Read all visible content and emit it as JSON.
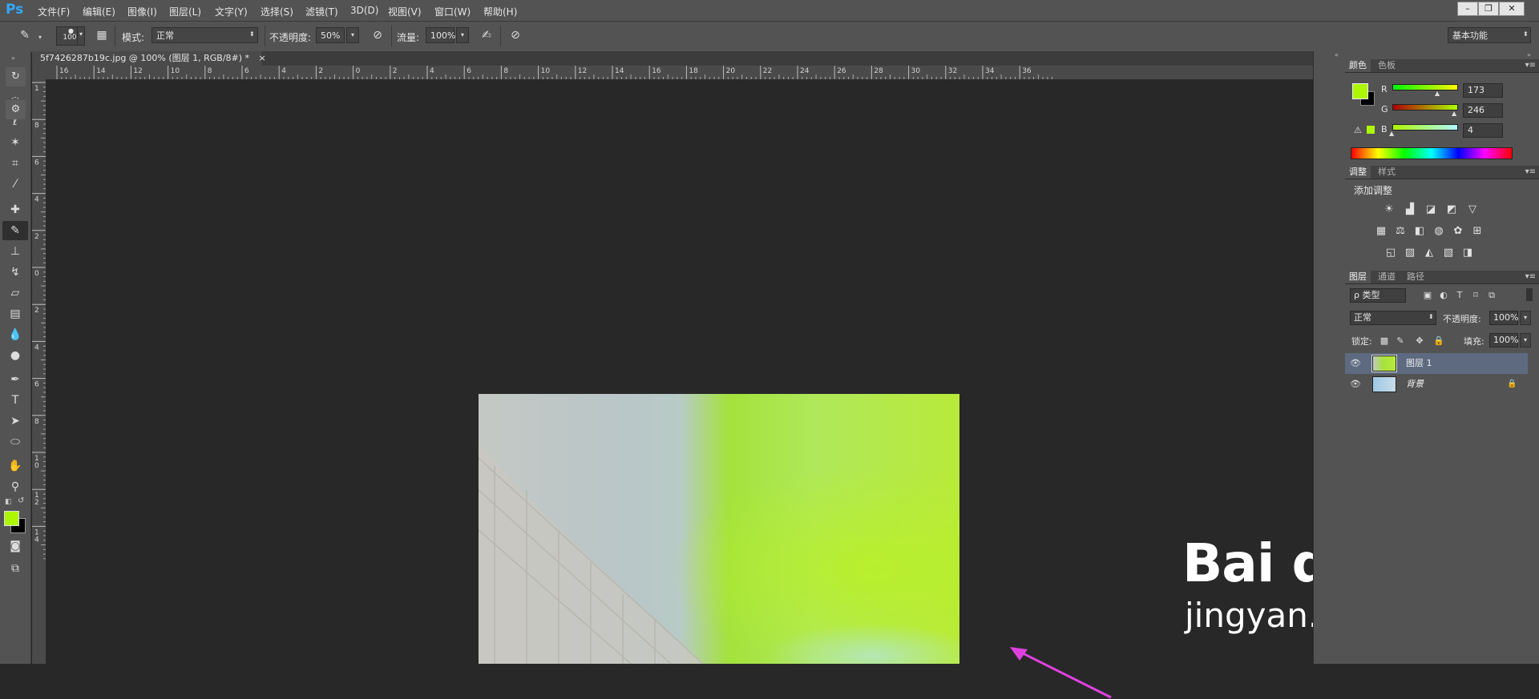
{
  "app": {
    "logo": "Ps"
  },
  "menu": [
    "文件(F)",
    "编辑(E)",
    "图像(I)",
    "图层(L)",
    "文字(Y)",
    "选择(S)",
    "滤镜(T)",
    "3D(D)",
    "视图(V)",
    "窗口(W)",
    "帮助(H)"
  ],
  "window_controls": {
    "minimize": "–",
    "restore": "❐",
    "close": "✕"
  },
  "options": {
    "brush_size": "100",
    "mode_label": "模式:",
    "mode_value": "正常",
    "opacity_label": "不透明度:",
    "opacity_value": "50%",
    "flow_label": "流量:",
    "flow_value": "100%",
    "workspace": "基本功能"
  },
  "document": {
    "tab_title": "5f7426287b19c.jpg @ 100% (图层 1, RGB/8#) *",
    "tab_close": "×"
  },
  "rulers": {
    "top": [
      "16",
      "14",
      "12",
      "10",
      "8",
      "6",
      "4",
      "2",
      "0",
      "2",
      "4",
      "6",
      "8",
      "10",
      "12",
      "14",
      "16",
      "18",
      "20",
      "22",
      "24",
      "26",
      "28",
      "30",
      "32",
      "34",
      "36"
    ],
    "left": [
      "1",
      "8",
      "6",
      "4",
      "2",
      "0",
      "2",
      "4",
      "6",
      "8",
      "10",
      "12",
      "14"
    ]
  },
  "color_panel": {
    "tabs": [
      "颜色",
      "色板"
    ],
    "r_label": "R",
    "g_label": "G",
    "b_label": "B",
    "r": "173",
    "g": "246",
    "b": "4",
    "foreground": "#adf604",
    "background": "#000000"
  },
  "adjustments_panel": {
    "tabs": [
      "调整",
      "样式"
    ],
    "title": "添加调整"
  },
  "layers_panel": {
    "tabs": [
      "图层",
      "通道",
      "路径"
    ],
    "filter_kind": "ρ 类型",
    "blend_mode": "正常",
    "opacity_label": "不透明度:",
    "opacity_value": "100%",
    "lock_label": "锁定:",
    "fill_label": "填充:",
    "fill_value": "100%",
    "layers": [
      {
        "name": "图层 1",
        "selected": true
      },
      {
        "name": "背景",
        "selected": false
      }
    ]
  },
  "watermark": {
    "logo": "Bai du 经验",
    "url": "jingyan.baidu.com"
  },
  "colors": {
    "accent_blue": "#31a8ff",
    "arrow_magenta": "#e040e0",
    "image_green": "#b8ea3a"
  }
}
